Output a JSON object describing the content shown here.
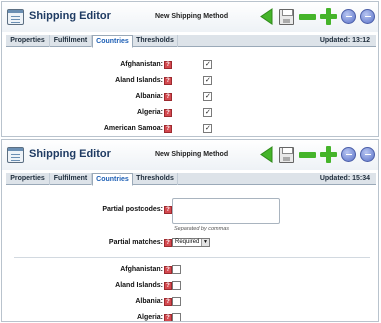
{
  "app": {
    "title": "Shipping Editor",
    "method_title": "New Shipping Method"
  },
  "toolbar": {
    "icons": [
      "back-arrow-icon",
      "save-icon",
      "minus-icon",
      "plus-icon",
      "circle-minus-icon",
      "circle-minus-icon"
    ],
    "accent": "#45b42a",
    "circle_color": "#5a72c8"
  },
  "tabs": [
    "Properties",
    "Fulfilment",
    "Countries",
    "Thresholds"
  ],
  "active_tab": "Countries",
  "help_glyph": "?",
  "panel1": {
    "updated": "Updated: 13:12",
    "countries": [
      {
        "name": "Afghanistan:",
        "checked": true
      },
      {
        "name": "Aland Islands:",
        "checked": true
      },
      {
        "name": "Albania:",
        "checked": true
      },
      {
        "name": "Algeria:",
        "checked": true
      },
      {
        "name": "American Samoa:",
        "checked": true
      }
    ]
  },
  "panel2": {
    "updated": "Updated: 15:34",
    "partial_postcodes_label": "Partial postcodes:",
    "postcodes_hint": "Separated by commas",
    "partial_matches_label": "Partial matches:",
    "partial_matches_value": "Required",
    "countries": [
      {
        "name": "Afghanistan:",
        "checked": false
      },
      {
        "name": "Aland Islands:",
        "checked": false
      },
      {
        "name": "Albania:",
        "checked": false
      },
      {
        "name": "Algeria:",
        "checked": false
      }
    ]
  }
}
